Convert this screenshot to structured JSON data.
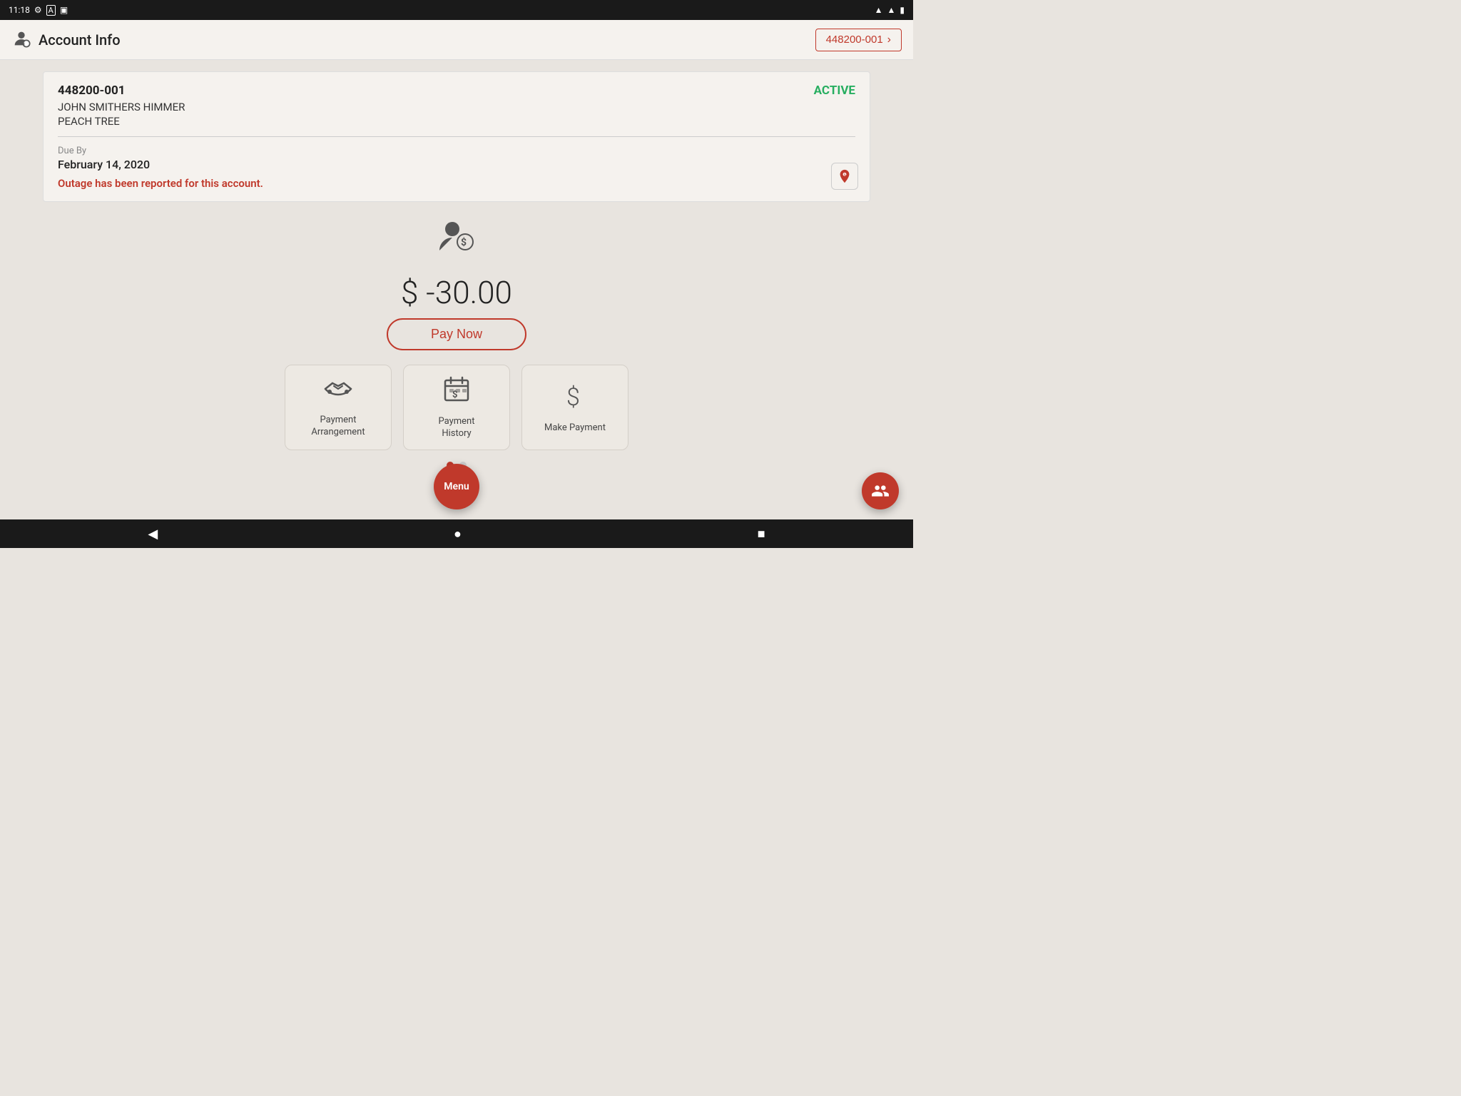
{
  "statusBar": {
    "time": "11:18",
    "icons": [
      "settings",
      "a-icon",
      "sim-icon"
    ]
  },
  "header": {
    "title": "Account Info",
    "accountNumber": "448200-001",
    "chevron": "›"
  },
  "accountCard": {
    "accountNumber": "448200-001",
    "status": "ACTIVE",
    "name": "JOHN SMITHERS HIMMER",
    "location": "PEACH TREE",
    "dueByLabel": "Due By",
    "dueDate": "February 14, 2020",
    "outageMessage": "Outage has been reported for this account."
  },
  "balance": {
    "amount": "$ -30.00",
    "payNowLabel": "Pay Now"
  },
  "actions": [
    {
      "id": "payment-arrangement",
      "label": "Payment\nArrangement",
      "icon": "handshake"
    },
    {
      "id": "payment-history",
      "label": "Payment\nHistory",
      "icon": "calendar-dollar"
    },
    {
      "id": "make-payment",
      "label": "Make Payment",
      "icon": "dollar-sign"
    }
  ],
  "pagination": {
    "total": 2,
    "active": 0
  },
  "menuLabel": "Menu",
  "navBar": {
    "back": "◀",
    "home": "●",
    "recent": "■"
  }
}
